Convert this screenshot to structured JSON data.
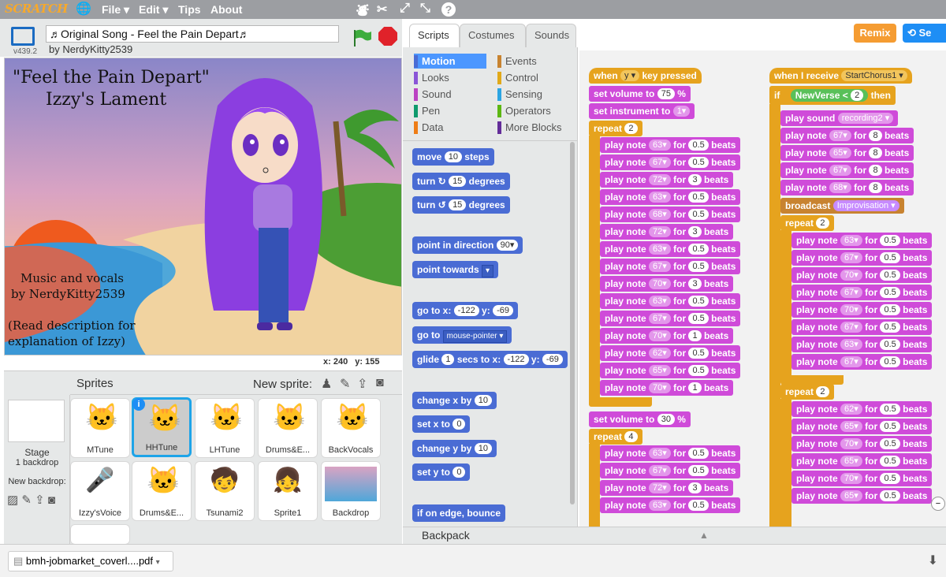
{
  "menubar": {
    "logo": "SCRATCH",
    "file": "File ▾",
    "edit": "Edit ▾",
    "tips": "Tips",
    "about": "About"
  },
  "project": {
    "version": "v439.2",
    "title": "♬Original Song - Feel the Pain Depart♬",
    "author": "by NerdyKitty2539"
  },
  "stage_text": {
    "title1": "\"Feel the Pain Depart\"",
    "title2": "Izzy's Lament",
    "credit1": "Music and vocals",
    "credit2": "by NerdyKitty2539",
    "note1": "(Read description for",
    "note2": "explanation of Izzy)"
  },
  "coords": {
    "x": "x: 240",
    "y": "y: 155"
  },
  "sprites_panel": {
    "title": "Sprites",
    "new_sprite": "New sprite:",
    "stage_label": "Stage",
    "stage_backdrops": "1 backdrop",
    "new_backdrop": "New backdrop:",
    "sprites": [
      {
        "name": "MTune"
      },
      {
        "name": "HHTune"
      },
      {
        "name": "LHTune"
      },
      {
        "name": "Drums&E..."
      },
      {
        "name": "BackVocals"
      },
      {
        "name": "Izzy'sVoice"
      },
      {
        "name": "Drums&E..."
      },
      {
        "name": "Tsunami2"
      },
      {
        "name": "Sprite1"
      },
      {
        "name": "Backdrop"
      }
    ]
  },
  "tabs": {
    "scripts": "Scripts",
    "costumes": "Costumes",
    "sounds": "Sounds"
  },
  "buttons": {
    "remix": "Remix",
    "share": "Se"
  },
  "categories": {
    "motion": "Motion",
    "looks": "Looks",
    "sound": "Sound",
    "pen": "Pen",
    "data": "Data",
    "events": "Events",
    "control": "Control",
    "sensing": "Sensing",
    "operators": "Operators",
    "more": "More Blocks"
  },
  "palette": {
    "move": [
      "move",
      "10",
      "steps"
    ],
    "turn_cw": [
      "turn ↻",
      "15",
      "degrees"
    ],
    "turn_ccw": [
      "turn ↺",
      "15",
      "degrees"
    ],
    "point_dir": [
      "point in direction",
      "90▾"
    ],
    "point_towards": [
      "point towards",
      "▾"
    ],
    "goto_xy": [
      "go to x:",
      "-122",
      "y:",
      "-69"
    ],
    "goto": [
      "go to",
      "mouse-pointer ▾"
    ],
    "glide": [
      "glide",
      "1",
      "secs to x:",
      "-122",
      "y:",
      "-69"
    ],
    "change_x": [
      "change x by",
      "10"
    ],
    "set_x": [
      "set x to",
      "0"
    ],
    "change_y": [
      "change y by",
      "10"
    ],
    "set_y": [
      "set y to",
      "0"
    ],
    "bounce": [
      "if on edge, bounce"
    ]
  },
  "backpack": "Backpack",
  "script1": {
    "hat": [
      "when",
      "y ▾",
      "key pressed"
    ],
    "volume1": [
      "set volume to",
      "75",
      "%"
    ],
    "instrument": [
      "set instrument to",
      "1▾"
    ],
    "repeat1": [
      "repeat",
      "2"
    ],
    "notes1": [
      [
        "63▾",
        "0.5"
      ],
      [
        "67▾",
        "0.5"
      ],
      [
        "72▾",
        "3"
      ],
      [
        "63▾",
        "0.5"
      ],
      [
        "68▾",
        "0.5"
      ],
      [
        "72▾",
        "3"
      ],
      [
        "63▾",
        "0.5"
      ],
      [
        "67▾",
        "0.5"
      ],
      [
        "70▾",
        "3"
      ],
      [
        "63▾",
        "0.5"
      ],
      [
        "67▾",
        "0.5"
      ],
      [
        "70▾",
        "1"
      ],
      [
        "62▾",
        "0.5"
      ],
      [
        "65▾",
        "0.5"
      ],
      [
        "70▾",
        "1"
      ]
    ],
    "volume2": [
      "set volume to",
      "30",
      "%"
    ],
    "repeat2": [
      "repeat",
      "4"
    ],
    "notes2": [
      [
        "63▾",
        "0.5"
      ],
      [
        "67▾",
        "0.5"
      ],
      [
        "72▾",
        "3"
      ],
      [
        "63▾",
        "0.5"
      ]
    ]
  },
  "script2": {
    "hat": [
      "when I receive",
      "StartChorus1 ▾"
    ],
    "if": [
      "if",
      "NewVerse",
      "<",
      "2",
      "then"
    ],
    "sound": [
      "play sound",
      "recording2 ▾"
    ],
    "notes_top": [
      [
        "67▾",
        "8"
      ],
      [
        "65▾",
        "8"
      ],
      [
        "67▾",
        "8"
      ],
      [
        "68▾",
        "8"
      ]
    ],
    "broadcast": [
      "broadcast",
      "Improvisation ▾"
    ],
    "repeat1": [
      "repeat",
      "2"
    ],
    "notes1": [
      [
        "63▾",
        "0.5"
      ],
      [
        "67▾",
        "0.5"
      ],
      [
        "70▾",
        "0.5"
      ],
      [
        "67▾",
        "0.5"
      ],
      [
        "70▾",
        "0.5"
      ],
      [
        "67▾",
        "0.5"
      ],
      [
        "63▾",
        "0.5"
      ],
      [
        "67▾",
        "0.5"
      ]
    ],
    "repeat2": [
      "repeat",
      "2"
    ],
    "notes2": [
      [
        "62▾",
        "0.5"
      ],
      [
        "65▾",
        "0.5"
      ],
      [
        "70▾",
        "0.5"
      ],
      [
        "65▾",
        "0.5"
      ],
      [
        "70▾",
        "0.5"
      ],
      [
        "65▾",
        "0.5"
      ]
    ]
  },
  "block_words": {
    "play_note": "play note",
    "for": "for",
    "beats": "beats"
  },
  "download": {
    "file": "bmh-jobmarket_coverl....pdf"
  }
}
